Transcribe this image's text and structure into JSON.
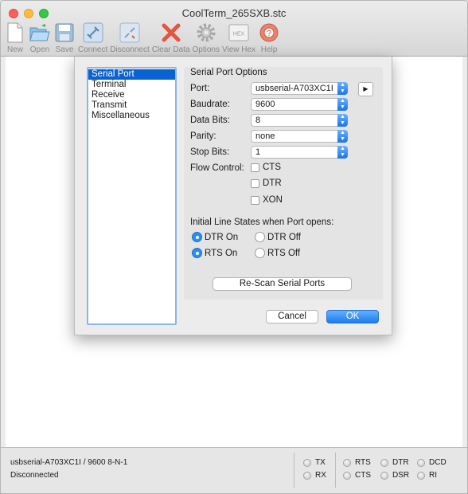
{
  "window": {
    "title": "CoolTerm_265SXB.stc"
  },
  "toolbar": {
    "items": [
      {
        "label": "New",
        "icon": "new-document-icon"
      },
      {
        "label": "Open",
        "icon": "open-folder-icon"
      },
      {
        "label": "Save",
        "icon": "floppy-disk-icon"
      },
      {
        "label": "Connect",
        "icon": "connect-plug-icon"
      },
      {
        "label": "Disconnect",
        "icon": "disconnect-plug-icon"
      },
      {
        "label": "Clear Data",
        "icon": "red-x-icon"
      },
      {
        "label": "Options",
        "icon": "gear-icon"
      },
      {
        "label": "View Hex",
        "icon": "hex-icon",
        "badge": "HEX"
      },
      {
        "label": "Help",
        "icon": "lifebuoy-help-icon"
      }
    ]
  },
  "dialog": {
    "categories": [
      "Serial Port",
      "Terminal",
      "Receive",
      "Transmit",
      "Miscellaneous"
    ],
    "selected_category": "Serial Port",
    "section_title": "Serial Port Options",
    "port": {
      "label": "Port:",
      "value": "usbserial-A703XC1I"
    },
    "baudrate": {
      "label": "Baudrate:",
      "value": "9600"
    },
    "data_bits": {
      "label": "Data Bits:",
      "value": "8"
    },
    "parity": {
      "label": "Parity:",
      "value": "none"
    },
    "stop_bits": {
      "label": "Stop Bits:",
      "value": "1"
    },
    "flow_control": {
      "label": "Flow Control:",
      "options": [
        {
          "label": "CTS",
          "checked": false
        },
        {
          "label": "DTR",
          "checked": false
        },
        {
          "label": "XON",
          "checked": false
        }
      ]
    },
    "line_states": {
      "label": "Initial Line States when Port opens:",
      "dtr_on": "DTR On",
      "dtr_off": "DTR Off",
      "rts_on": "RTS On",
      "rts_off": "RTS Off",
      "dtr_selected": "DTR On",
      "rts_selected": "RTS On"
    },
    "rescan_label": "Re-Scan Serial Ports",
    "cancel_label": "Cancel",
    "ok_label": "OK"
  },
  "statusbar": {
    "connection": "usbserial-A703XC1I / 9600 8-N-1",
    "state": "Disconnected",
    "leds": [
      "TX",
      "RX",
      "RTS",
      "CTS",
      "DTR",
      "DSR",
      "DCD",
      "RI"
    ]
  },
  "colors": {
    "accent": "#1a7bef",
    "selection": "#0a62d1",
    "close": "#fc605c",
    "minimize": "#fdbc40",
    "maximize": "#34c84a"
  }
}
